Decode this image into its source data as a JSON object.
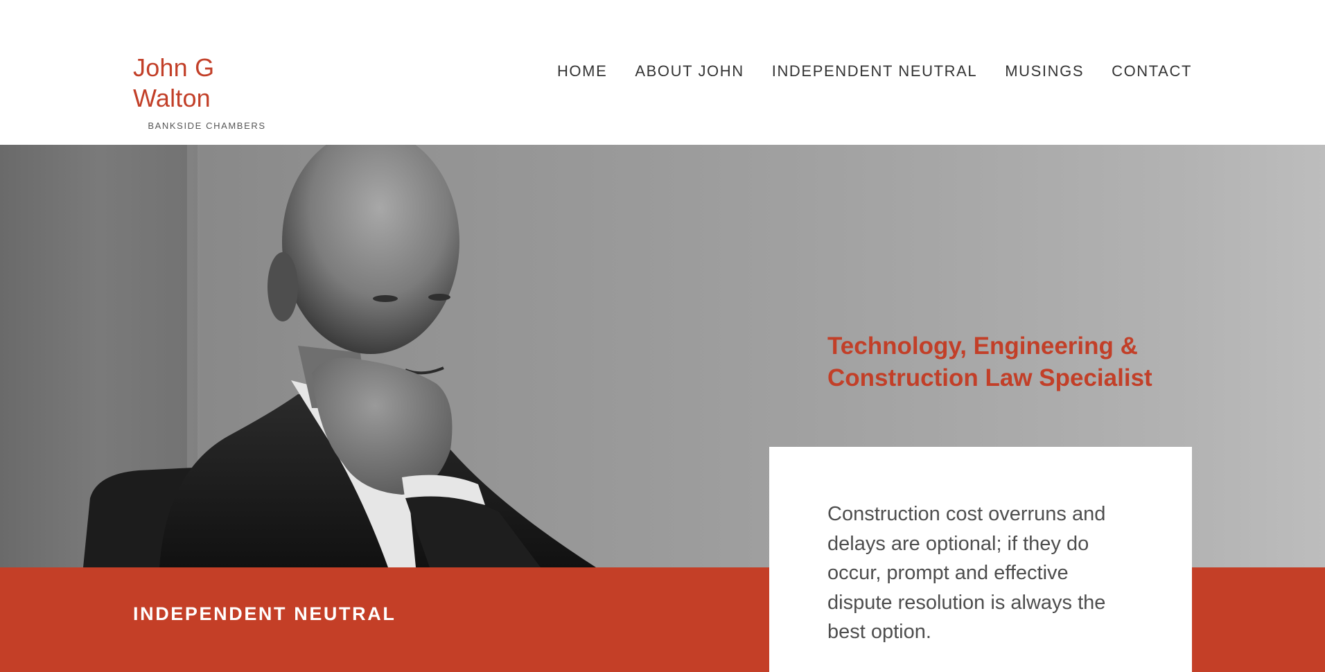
{
  "site": {
    "name": "John G Walton",
    "subtitle": "BANKSIDE CHAMBERS"
  },
  "nav": {
    "items": [
      {
        "label": "HOME"
      },
      {
        "label": "ABOUT JOHN"
      },
      {
        "label": "INDEPENDENT NEUTRAL"
      },
      {
        "label": "MUSINGS"
      },
      {
        "label": "CONTACT"
      }
    ]
  },
  "hero": {
    "tagline_line1": "Technology, Engineering &",
    "tagline_line2": "Construction Law Specialist",
    "photo": "black-and-white portrait of John G Walton"
  },
  "band": {
    "label": "INDEPENDENT NEUTRAL"
  },
  "quote": {
    "text": "Construction cost overruns and delays are optional; if they do occur, prompt and effective dispute resolution is always the best option."
  },
  "colors": {
    "accent": "#c23f28",
    "band": "#c43f27",
    "nav_text": "#333333",
    "body_text": "#4d4d4d"
  }
}
